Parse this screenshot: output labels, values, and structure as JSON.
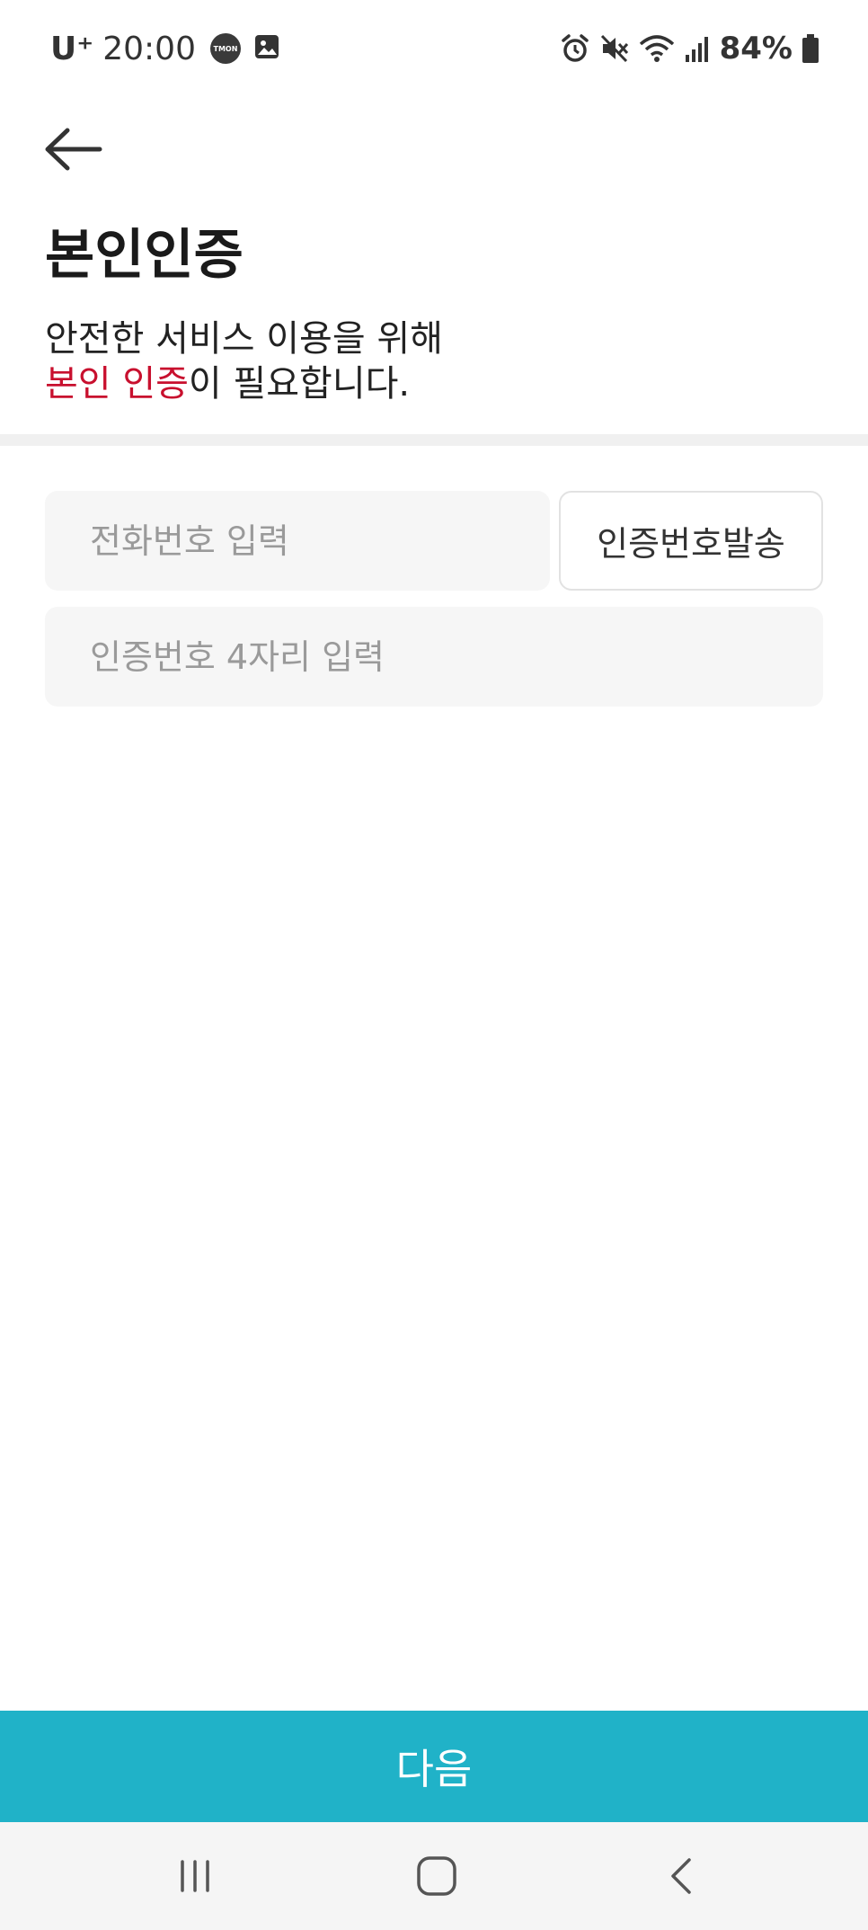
{
  "status_bar": {
    "carrier": "U⁺",
    "time": "20:00",
    "notification_icons": [
      "tmon-icon",
      "gallery-icon"
    ],
    "tmon_label": "TMON",
    "system_icons": [
      "alarm-icon",
      "mute-icon",
      "wifi-icon",
      "signal-icon"
    ],
    "battery_percent": "84%",
    "battery_level": 0.84
  },
  "header": {
    "back_icon": "arrow-left-icon",
    "title": "본인인증",
    "description_line1": "안전한 서비스 이용을 위해",
    "description_highlight": "본인 인증",
    "description_rest": "이 필요합니다."
  },
  "form": {
    "phone_placeholder": "전화번호 입력",
    "phone_value": "",
    "send_code_label": "인증번호발송",
    "code_placeholder": "인증번호 4자리 입력",
    "code_value": ""
  },
  "footer": {
    "next_label": "다음"
  },
  "nav_bar": {
    "icons": [
      "recents-icon",
      "home-icon",
      "back-icon"
    ]
  },
  "colors": {
    "accent": "#20b2c8",
    "highlight": "#c8102e",
    "input_bg": "#f6f6f6",
    "divider": "#f0f0f0",
    "nav_bg": "#f5f5f5"
  }
}
